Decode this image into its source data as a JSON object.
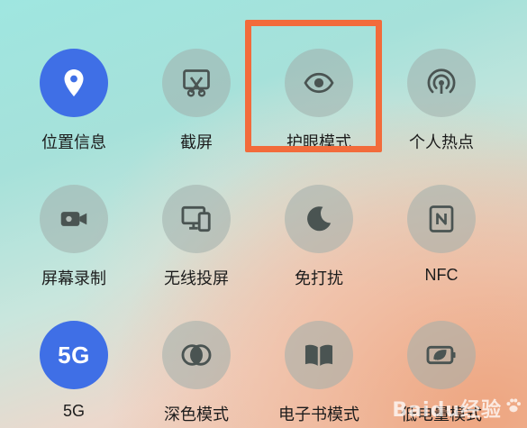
{
  "tiles": [
    {
      "label": "位置信息",
      "icon": "location-pin-icon",
      "active": true
    },
    {
      "label": "截屏",
      "icon": "screenshot-scissors-icon",
      "active": false
    },
    {
      "label": "护眼模式",
      "icon": "eye-icon",
      "active": false,
      "highlighted": true
    },
    {
      "label": "个人热点",
      "icon": "hotspot-icon",
      "active": false
    },
    {
      "label": "屏幕录制",
      "icon": "video-camera-icon",
      "active": false
    },
    {
      "label": "无线投屏",
      "icon": "screen-cast-icon",
      "active": false
    },
    {
      "label": "免打扰",
      "icon": "moon-icon",
      "active": false
    },
    {
      "label": "NFC",
      "icon": "nfc-icon",
      "active": false
    },
    {
      "label": "5G",
      "icon_text": "5G",
      "active": true
    },
    {
      "label": "深色模式",
      "icon": "dark-mode-icon",
      "active": false
    },
    {
      "label": "电子书模式",
      "icon": "book-icon",
      "active": false
    },
    {
      "label": "低电量模式",
      "icon": "battery-leaf-icon",
      "active": false
    }
  ],
  "watermark": "Baidu经验",
  "colors": {
    "active_blue": "#3f6fe6",
    "highlight_orange": "#f26b3b",
    "icon_gray": "#4a5452"
  }
}
